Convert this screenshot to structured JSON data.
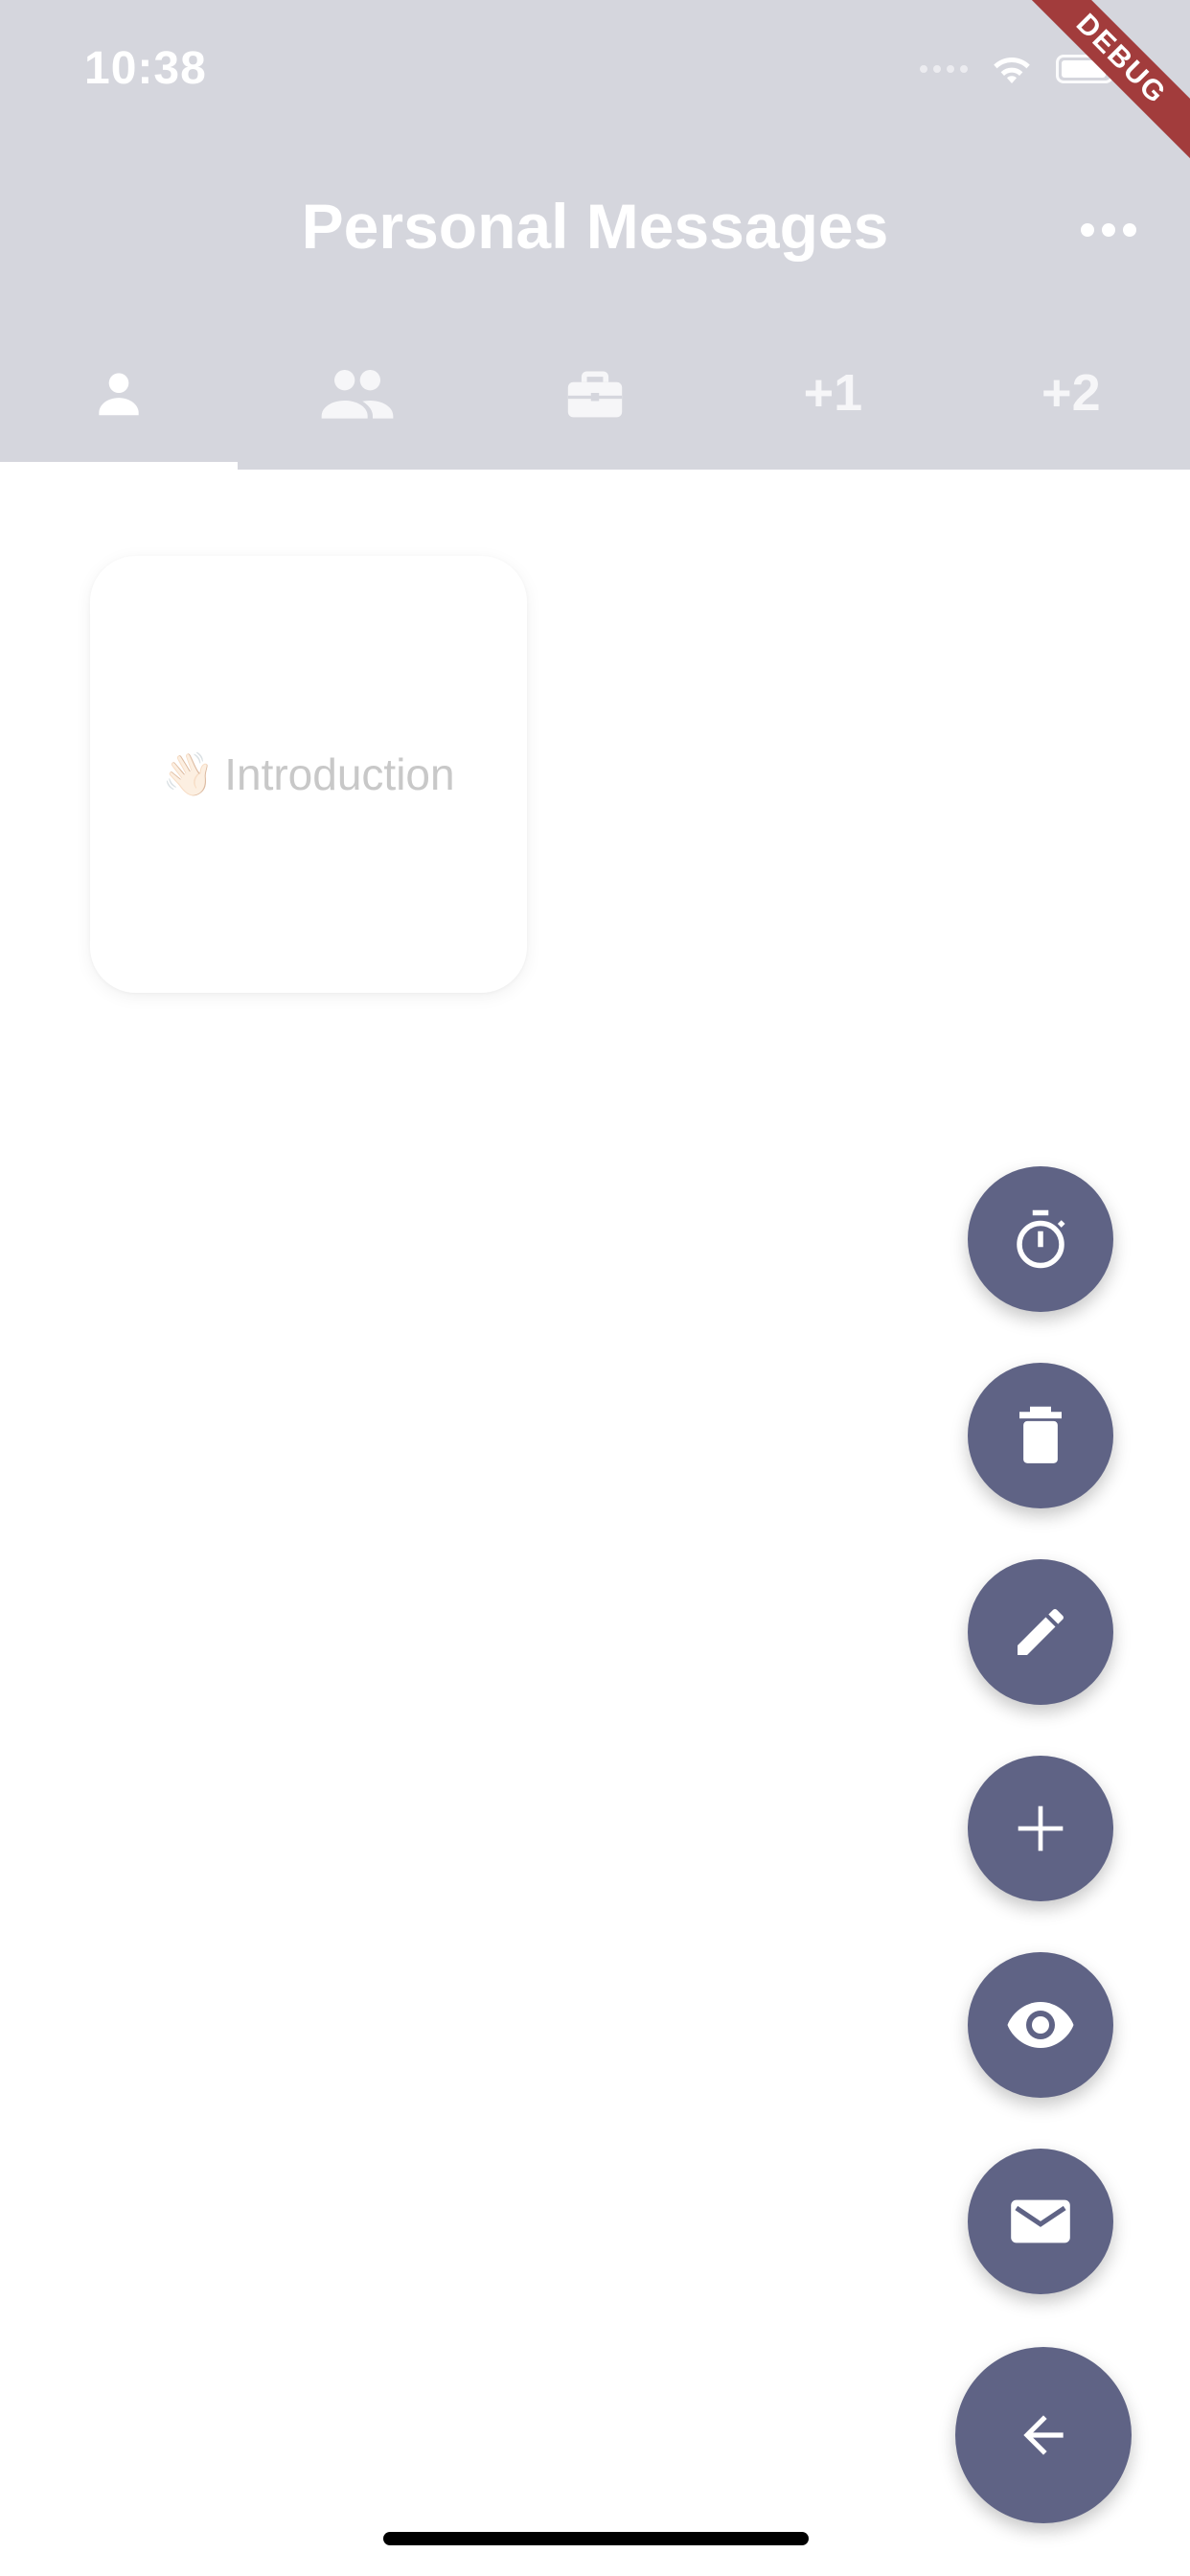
{
  "status_bar": {
    "time": "10:38",
    "icons": [
      "cellular-signal-icon",
      "wifi-icon",
      "battery-icon"
    ]
  },
  "debug_banner": "DEBUG",
  "header": {
    "title": "Personal Messages",
    "more_icon": "more-horizontal-icon",
    "background": "#d5d6dd"
  },
  "tabs": [
    {
      "icon": "person-icon",
      "label": "",
      "selected": true
    },
    {
      "icon": "people-icon",
      "label": "",
      "selected": false
    },
    {
      "icon": "briefcase-icon",
      "label": "",
      "selected": false
    },
    {
      "icon": "",
      "label": "+1",
      "selected": false
    },
    {
      "icon": "",
      "label": "+2",
      "selected": false
    }
  ],
  "cards": [
    {
      "emoji": "👋🏻",
      "label": "Introduction"
    }
  ],
  "fab_buttons": [
    {
      "icon": "timer-icon"
    },
    {
      "icon": "delete-icon"
    },
    {
      "icon": "edit-icon"
    },
    {
      "icon": "add-icon"
    },
    {
      "icon": "eye-icon"
    },
    {
      "icon": "mail-icon"
    },
    {
      "icon": "arrow-back-icon"
    }
  ],
  "colors": {
    "fab": "#5f6385",
    "debug": "#a23c3c"
  }
}
